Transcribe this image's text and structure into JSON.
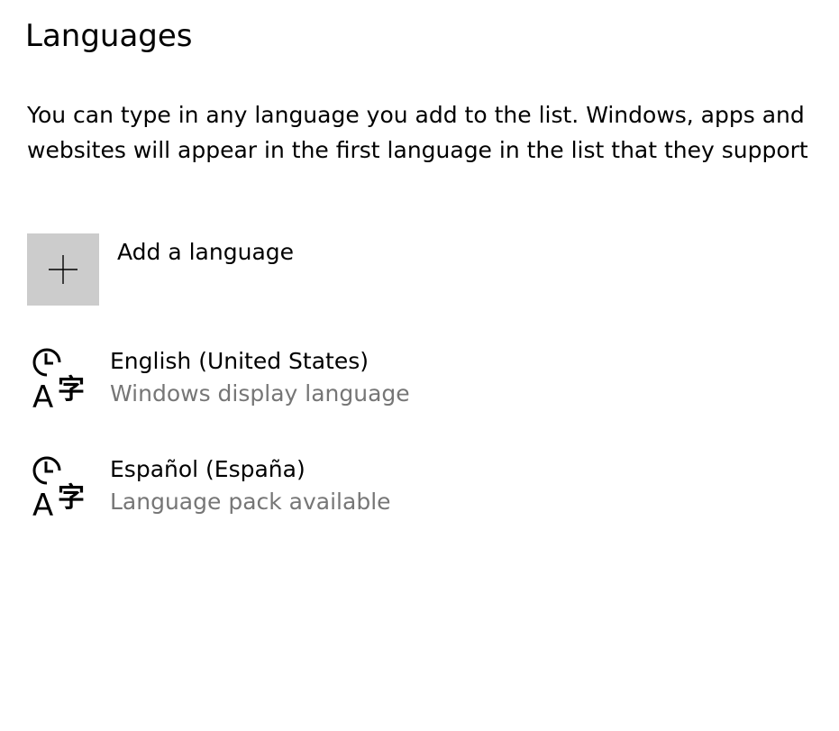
{
  "page": {
    "title": "Languages",
    "description": "You can type in any language you add to the list. Windows, apps and websites will appear in the first language in the list that they support"
  },
  "add_language": {
    "label": "Add a language",
    "icon": "plus-icon",
    "tile_color": "#cccccc"
  },
  "languages": [
    {
      "name": "English (United States)",
      "status": "Windows display language",
      "icon": "language-icon"
    },
    {
      "name": "Español (España)",
      "status": "Language pack available",
      "icon": "language-icon"
    }
  ],
  "colors": {
    "secondary_text": "#767676",
    "text": "#000000",
    "background": "#ffffff"
  }
}
